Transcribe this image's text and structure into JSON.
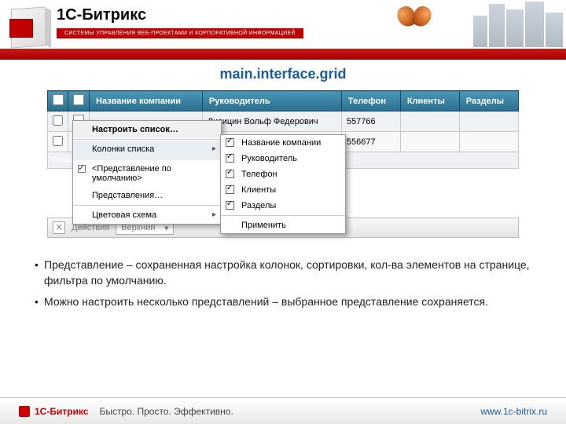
{
  "header": {
    "brand": "1С-Битрикс",
    "tagline": "СИСТЕМЫ УПРАВЛЕНИЯ ВЕБ-ПРОЕКТАМИ И КОРПОРАТИВНОЙ ИНФОРМАЦИЕЙ"
  },
  "title": "main.interface.grid",
  "grid": {
    "columns": [
      "Название компании",
      "Руководитель",
      "Телефон",
      "Клиенты",
      "Разделы"
    ],
    "rows": [
      {
        "leader": "Лисицин Вольф Федерович",
        "phone": "557766"
      },
      {
        "leader": "",
        "phone": "556677"
      }
    ],
    "selectedLabel": "Отмеч"
  },
  "popmenu": {
    "configure": "Настроить список…",
    "columns": "Колонки списка",
    "defaultView": "<Представление по умолчанию>",
    "views": "Представления…",
    "colorScheme": "Цветовая схема"
  },
  "submenu": {
    "items": [
      {
        "label": "Название компании",
        "checked": true
      },
      {
        "label": "Руководитель",
        "checked": true
      },
      {
        "label": "Телефон",
        "checked": true
      },
      {
        "label": "Клиенты",
        "checked": true
      },
      {
        "label": "Разделы",
        "checked": true
      }
    ],
    "apply": "Применить"
  },
  "actionbar": {
    "actions": "Действия",
    "dropdown": "Верхний"
  },
  "bullets": [
    "Представление – сохраненная настройка колонок, сортировки, кол-ва элементов на странице, фильтра по умолчанию.",
    "Можно настроить несколько представлений – выбранное представление сохраняется."
  ],
  "footer": {
    "brand": "1С-Битрикс",
    "slogan": "Быстро. Просто. Эффективно.",
    "url": "www.1c-bitrix.ru"
  }
}
